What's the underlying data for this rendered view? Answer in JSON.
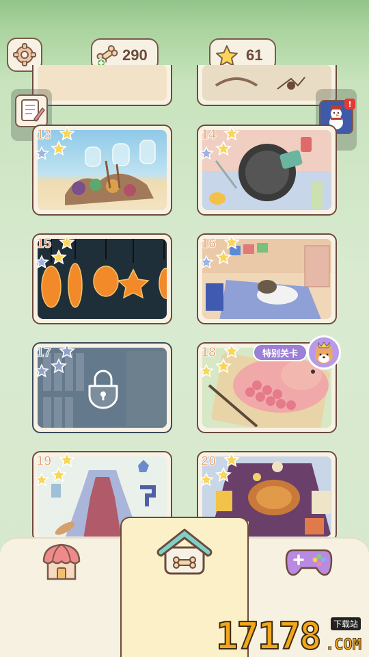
{
  "top_bar": {
    "settings_icon": "gear-icon",
    "bone_count": "290",
    "bone_icon": "bone-plus-icon",
    "star_count": "61",
    "star_icon": "star-icon"
  },
  "side_buttons": {
    "left_icon": "checklist-pencil-icon",
    "right_icon": "snowman-notification-icon",
    "right_badge": "!"
  },
  "levels": [
    {
      "number": "13",
      "stars": 3,
      "theme": "beach-bottles",
      "locked": false
    },
    {
      "number": "14",
      "stars": 3,
      "theme": "kitchen-pan",
      "locked": false
    },
    {
      "number": "15",
      "stars": 3,
      "theme": "glowing-bulbs",
      "locked": false
    },
    {
      "number": "16",
      "stars": 3,
      "theme": "bedroom-cat",
      "locked": false
    },
    {
      "number": "17",
      "stars": 3,
      "theme": "shelves-locked",
      "locked": true
    },
    {
      "number": "18",
      "stars": 3,
      "theme": "fish-butcher",
      "locked": false
    },
    {
      "number": "19",
      "stars": 3,
      "theme": "dress-cleaning",
      "locked": false
    },
    {
      "number": "20",
      "stars": 3,
      "theme": "feast-table",
      "locked": false
    }
  ],
  "special_level": {
    "label": "特别关卡",
    "avatar_icon": "shiba-crown-icon"
  },
  "bottom_nav": {
    "items": [
      {
        "icon": "shop-icon",
        "active": false
      },
      {
        "icon": "home-bone-icon",
        "active": true
      },
      {
        "icon": "gamepad-icon",
        "active": false
      }
    ]
  },
  "watermark": {
    "digits": "17178",
    "tag": "下载站",
    "domain": ".COM"
  },
  "colors": {
    "outline": "#6b4a3c",
    "card_bg": "#f8f1e4",
    "level_num": "#e8a070",
    "star": "#f9d65a",
    "special": "#9c7fd6"
  }
}
